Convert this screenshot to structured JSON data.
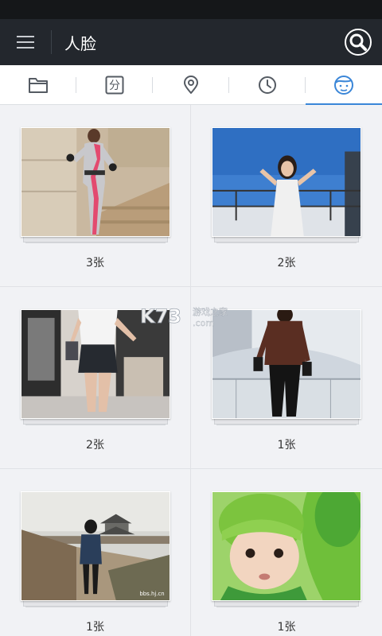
{
  "app_bar": {
    "title": "人脸",
    "menu_icon": "hamburger-menu-icon",
    "search_icon": "search-icon",
    "background": "#23272d"
  },
  "tabs": [
    {
      "icon": "folder-icon",
      "active": false
    },
    {
      "icon": "category-icon",
      "glyph": "分",
      "active": false
    },
    {
      "icon": "location-pin-icon",
      "active": false
    },
    {
      "icon": "clock-icon",
      "active": false
    },
    {
      "icon": "face-icon",
      "active": true
    }
  ],
  "accent_color": "#3a86d8",
  "albums": [
    {
      "count": "3张"
    },
    {
      "count": "2张"
    },
    {
      "count": "2张"
    },
    {
      "count": "1张"
    },
    {
      "count": "1张"
    },
    {
      "count": "1张"
    }
  ],
  "watermark": {
    "logo": "K73",
    "sub": "游戏之家",
    "domain": ".com"
  }
}
